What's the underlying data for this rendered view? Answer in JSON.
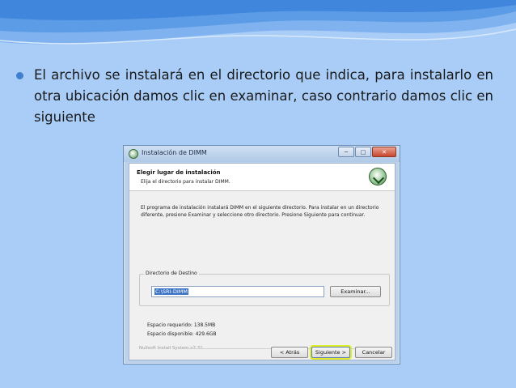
{
  "slide": {
    "bullet_text": "El archivo se instalará en el directorio que indica, para instalarlo en otra ubicación damos clic en examinar, caso contrario damos clic en siguiente"
  },
  "window": {
    "title": "Instalación de DIMM",
    "minimize_symbol": "─",
    "maximize_symbol": "□",
    "close_symbol": "✕"
  },
  "installer": {
    "header_title": "Elegir lugar de instalación",
    "header_subtitle": "Elija el directorio para instalar DIMM.",
    "description": "El programa de instalación instalará DIMM en el siguiente directorio. Para instalar en un directorio diferente, presione Examinar y seleccione otro directorio. Presione Siguiente para continuar.",
    "group_label": "Directorio de Destino",
    "destination_value": "C:\\SRI-DIMM",
    "browse_label": "Examinar...",
    "space_required": "Espacio requerido: 138.5MB",
    "space_available": "Espacio disponible: 429.6GB",
    "nsis_label": "Nullsoft Install System v2.31",
    "back_label": "< Atrás",
    "next_label": "Siguiente >",
    "cancel_label": "Cancelar"
  },
  "colors": {
    "background": "#a9cdf7",
    "bullet": "#3e7fcf",
    "next_highlight": "#e3ec2b"
  }
}
